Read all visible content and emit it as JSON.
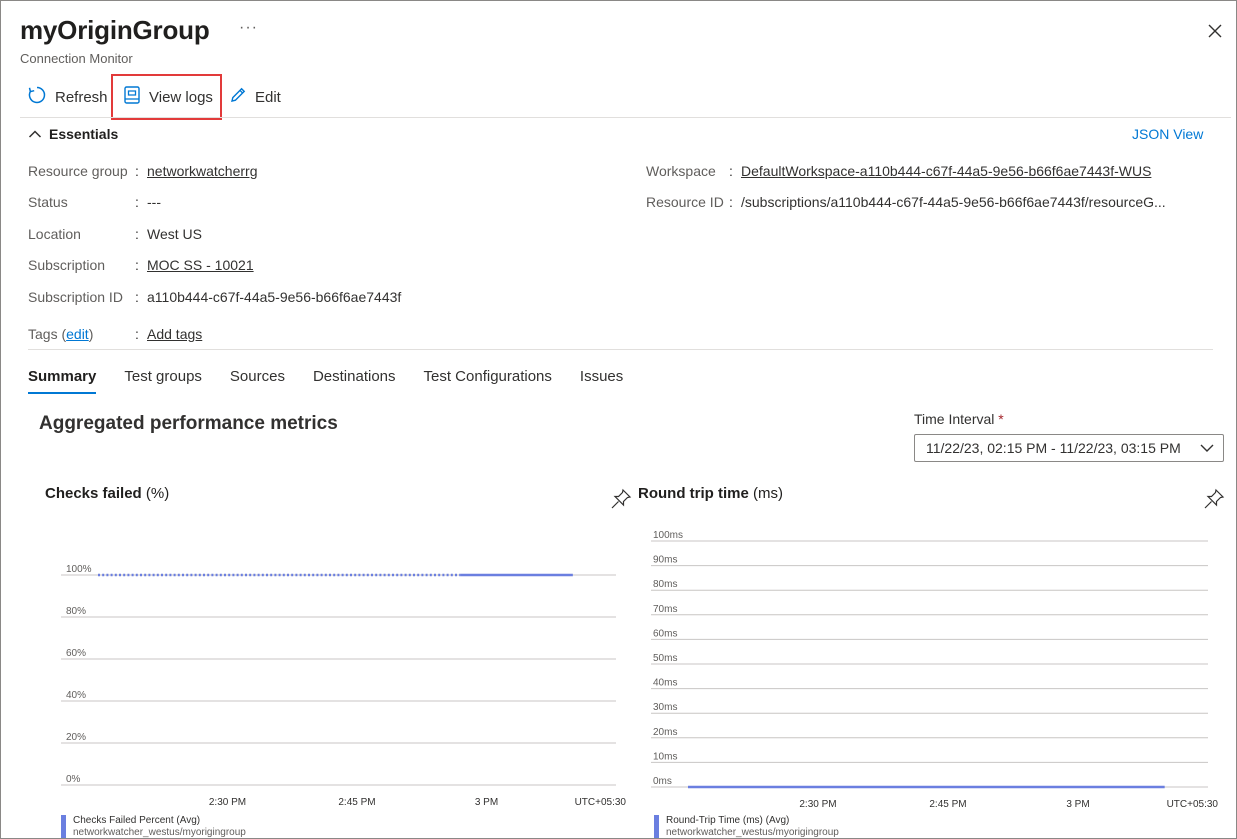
{
  "header": {
    "title": "myOriginGroup",
    "subtitle": "Connection Monitor",
    "more": "···"
  },
  "toolbar": {
    "refresh_label": "Refresh",
    "view_logs_label": "View logs",
    "edit_label": "Edit"
  },
  "essentials": {
    "heading": "Essentials",
    "json_view": "JSON View",
    "left": [
      {
        "key": "Resource group",
        "value": "networkwatcherrg",
        "link": true
      },
      {
        "key": "Status",
        "value": "---",
        "link": false
      },
      {
        "key": "Location",
        "value": "West US",
        "link": false
      },
      {
        "key": "Subscription",
        "value": "MOC SS - 10021",
        "link": true
      },
      {
        "key": "Subscription ID",
        "value": "a110b444-c67f-44a5-9e56-b66f6ae7443f",
        "link": false
      }
    ],
    "tags": {
      "key_prefix": "Tags (",
      "edit": "edit",
      "key_suffix": ")",
      "value": "Add tags"
    },
    "right": [
      {
        "key": "Workspace",
        "value": "DefaultWorkspace-a110b444-c67f-44a5-9e56-b66f6ae7443f-WUS",
        "link": true
      },
      {
        "key": "Resource ID",
        "value": "/subscriptions/a110b444-c67f-44a5-9e56-b66f6ae7443f/resourceG...",
        "link": false
      }
    ]
  },
  "tabs": [
    "Summary",
    "Test groups",
    "Sources",
    "Destinations",
    "Test Configurations",
    "Issues"
  ],
  "perf": {
    "title": "Aggregated performance metrics",
    "time_interval_label": "Time Interval",
    "time_interval_required": "*",
    "time_interval_value": "11/22/23, 02:15 PM - 11/22/23, 03:15 PM"
  },
  "colors": {
    "accent": "#0078d4",
    "series": "#6b7fe0",
    "highlight_border": "#e23a3a"
  },
  "chart_data": [
    {
      "type": "line",
      "title": "Checks failed",
      "title_unit": "(%)",
      "y_ticks": [
        "100%",
        "80%",
        "60%",
        "40%",
        "20%",
        "0%"
      ],
      "ylim": [
        0,
        100
      ],
      "x_ticks": [
        "2:30 PM",
        "2:45 PM",
        "3 PM"
      ],
      "x_tick_values": [
        "14:30",
        "14:45",
        "15:00"
      ],
      "xlim": [
        "14:15",
        "15:15"
      ],
      "timezone": "UTC+05:30",
      "series": [
        {
          "name": "Checks Failed Percent (Avg)",
          "sub": "networkwatcher_westus/myorigingroup",
          "dashed_x": [
            "14:15",
            "14:57"
          ],
          "solid_x": [
            "14:57",
            "15:10"
          ],
          "value": 100
        }
      ],
      "grid": true
    },
    {
      "type": "line",
      "title": "Round trip time",
      "title_unit": "(ms)",
      "y_ticks": [
        "100ms",
        "90ms",
        "80ms",
        "70ms",
        "60ms",
        "50ms",
        "40ms",
        "30ms",
        "20ms",
        "10ms",
        "0ms"
      ],
      "ylim": [
        0,
        100
      ],
      "x_ticks": [
        "2:30 PM",
        "2:45 PM",
        "3 PM"
      ],
      "x_tick_values": [
        "14:30",
        "14:45",
        "15:00"
      ],
      "xlim": [
        "14:15",
        "15:15"
      ],
      "timezone": "UTC+05:30",
      "series": [
        {
          "name": "Round-Trip Time (ms) (Avg)",
          "sub": "networkwatcher_westus/myorigingroup",
          "solid_x": [
            "14:15",
            "15:10"
          ],
          "value": 0
        }
      ],
      "grid": true
    }
  ]
}
